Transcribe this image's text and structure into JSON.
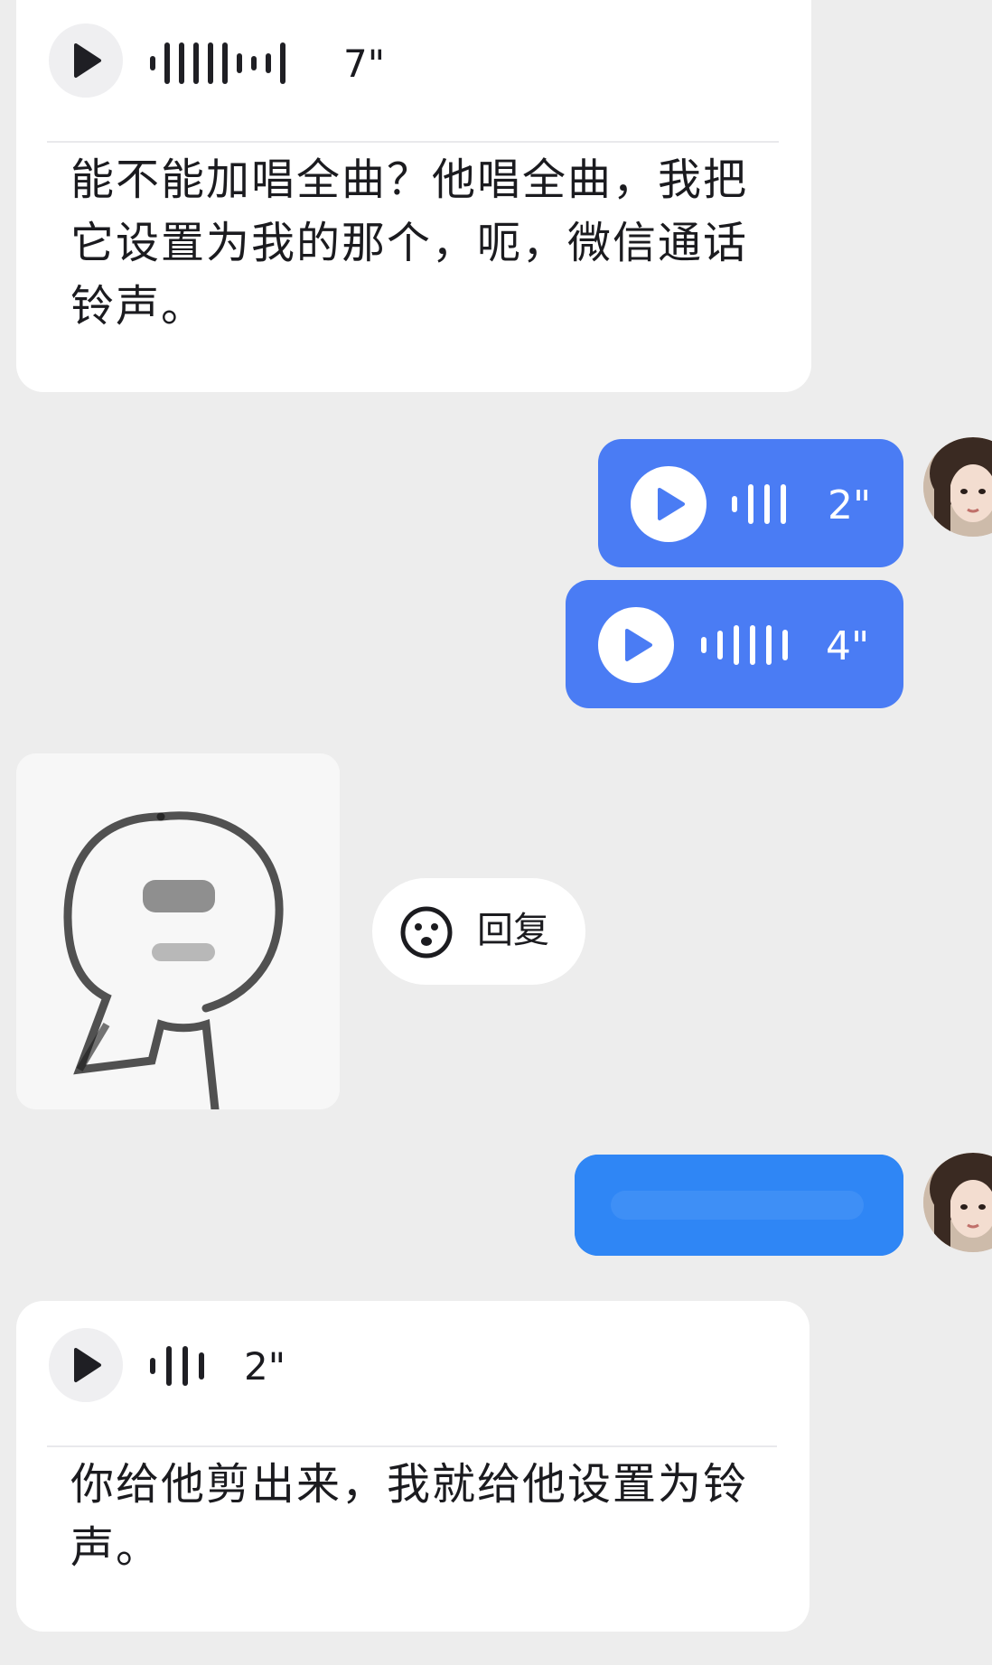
{
  "messages": [
    {
      "id": "m1",
      "direction": "incoming",
      "type": "voice_with_transcript",
      "duration": "7\"",
      "transcript": "能不能加唱全曲？他唱全曲，我把它设置为我的那个，呃，微信通话铃声。"
    },
    {
      "id": "m2",
      "direction": "outgoing",
      "type": "voice",
      "duration": "2\""
    },
    {
      "id": "m3",
      "direction": "outgoing",
      "type": "voice",
      "duration": "4\""
    },
    {
      "id": "m4",
      "direction": "incoming",
      "type": "sticker",
      "reply_label": "回复"
    },
    {
      "id": "m5",
      "direction": "outgoing",
      "type": "text_blurred"
    },
    {
      "id": "m6",
      "direction": "incoming",
      "type": "voice_with_transcript",
      "duration": "2\"",
      "transcript": "你给他剪出来，我就给他设置为铃声。"
    }
  ],
  "colors": {
    "background": "#ededed",
    "incoming_bubble": "#ffffff",
    "outgoing_voice_bubble": "#4a7cf4",
    "outgoing_text_bubble": "#2f86f5",
    "text": "#1b1b1f"
  },
  "icons": {
    "play": "play-icon",
    "waveform": "voice-waveform-icon",
    "reply_emoji": "smiley-icon"
  }
}
